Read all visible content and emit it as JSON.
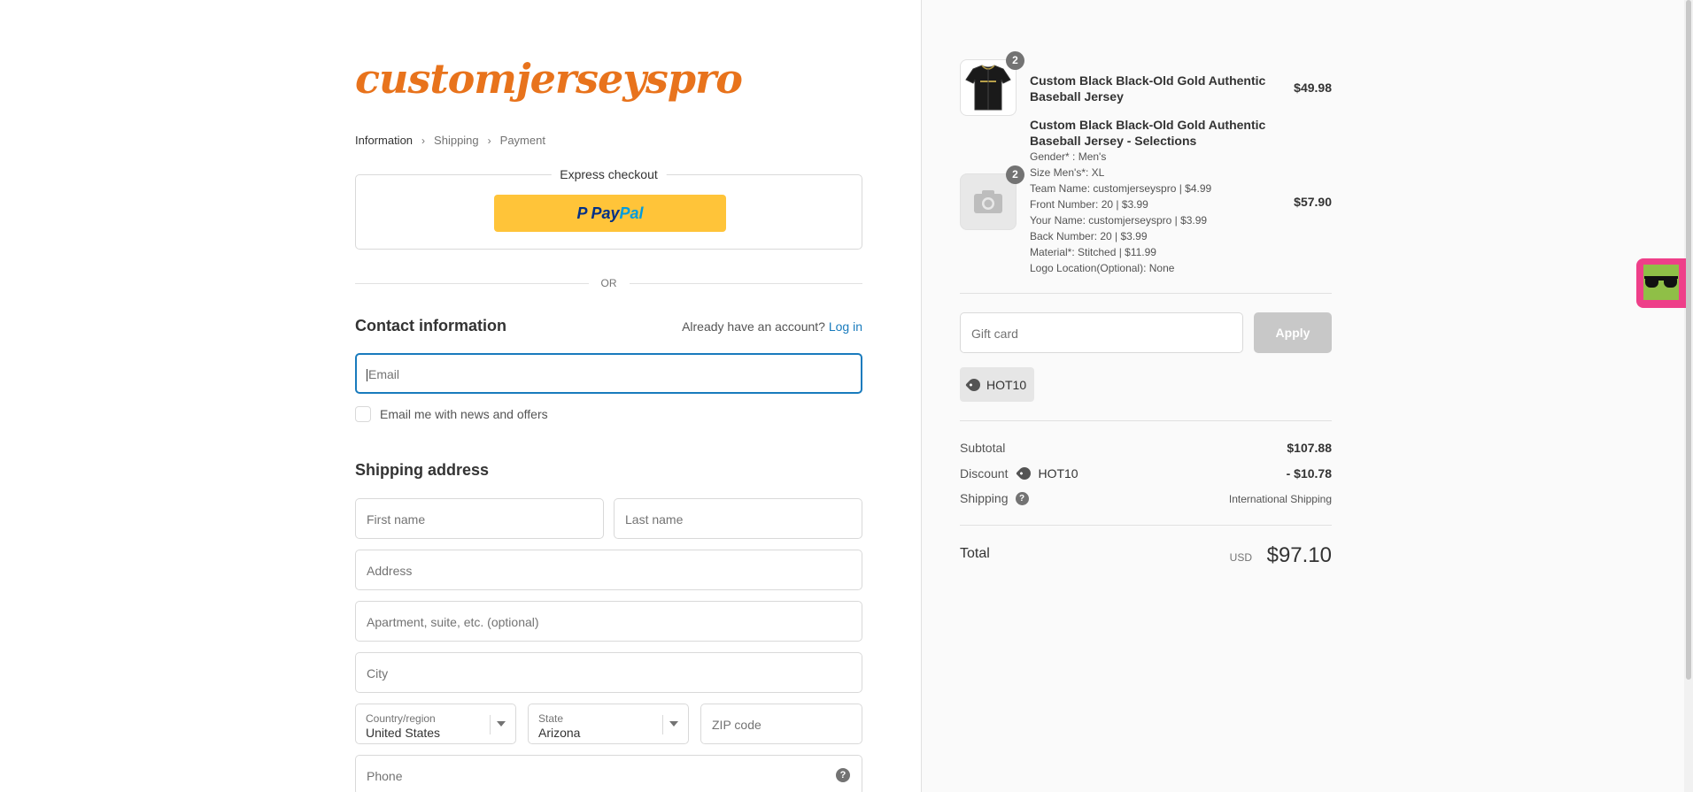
{
  "brand": {
    "logo_text": "customjerseyspro",
    "accent": "#e8731c"
  },
  "breadcrumb": {
    "items": [
      "Information",
      "Shipping",
      "Payment"
    ],
    "separator": "›"
  },
  "express": {
    "title": "Express checkout",
    "paypal_label_a": "Pay",
    "paypal_label_b": "Pal",
    "paypal_color": "#ffc439"
  },
  "divider_text": "OR",
  "contact": {
    "title": "Contact information",
    "have_account": "Already have an account?",
    "login_link": "Log in",
    "email_placeholder": "Email",
    "newsletter_label": "Email me with news and offers"
  },
  "shipping": {
    "title": "Shipping address",
    "first_name_placeholder": "First name",
    "last_name_placeholder": "Last name",
    "address_placeholder": "Address",
    "apartment_placeholder": "Apartment, suite, etc. (optional)",
    "city_placeholder": "City",
    "country_label": "Country/region",
    "country_value": "United States",
    "state_label": "State",
    "state_value": "Arizona",
    "zip_placeholder": "ZIP code",
    "phone_placeholder": "Phone"
  },
  "cart": {
    "items": [
      {
        "title": "Custom Black Black-Old Gold Authentic Baseball Jersey",
        "quantity": "2",
        "price": "$49.98",
        "thumbnail_icon": "jersey-image"
      },
      {
        "title": "Custom Black Black-Old Gold Authentic Baseball Jersey - Selections",
        "quantity": "2",
        "price": "$57.90",
        "thumbnail_icon": "camera-icon",
        "variants": [
          "Gender* : Men's",
          "Size Men's*: XL",
          "Team Name: customjerseyspro | $4.99",
          "Front Number: 20 | $3.99",
          "Your Name: customjerseyspro | $3.99",
          "Back Number: 20 | $3.99",
          "Material*: Stitched | $11.99",
          "Logo Location(Optional): None"
        ]
      }
    ]
  },
  "gift": {
    "placeholder": "Gift card",
    "apply_label": "Apply"
  },
  "discount_code": "HOT10",
  "totals": {
    "subtotal_label": "Subtotal",
    "subtotal_value": "$107.88",
    "discount_label": "Discount",
    "discount_code": "HOT10",
    "discount_value": "- $10.78",
    "shipping_label": "Shipping",
    "shipping_value": "International Shipping",
    "total_label": "Total",
    "currency": "USD",
    "total_value": "$97.10"
  },
  "widget": {
    "icon": "sunglasses-icon",
    "bg_color": "#ee3f89"
  }
}
